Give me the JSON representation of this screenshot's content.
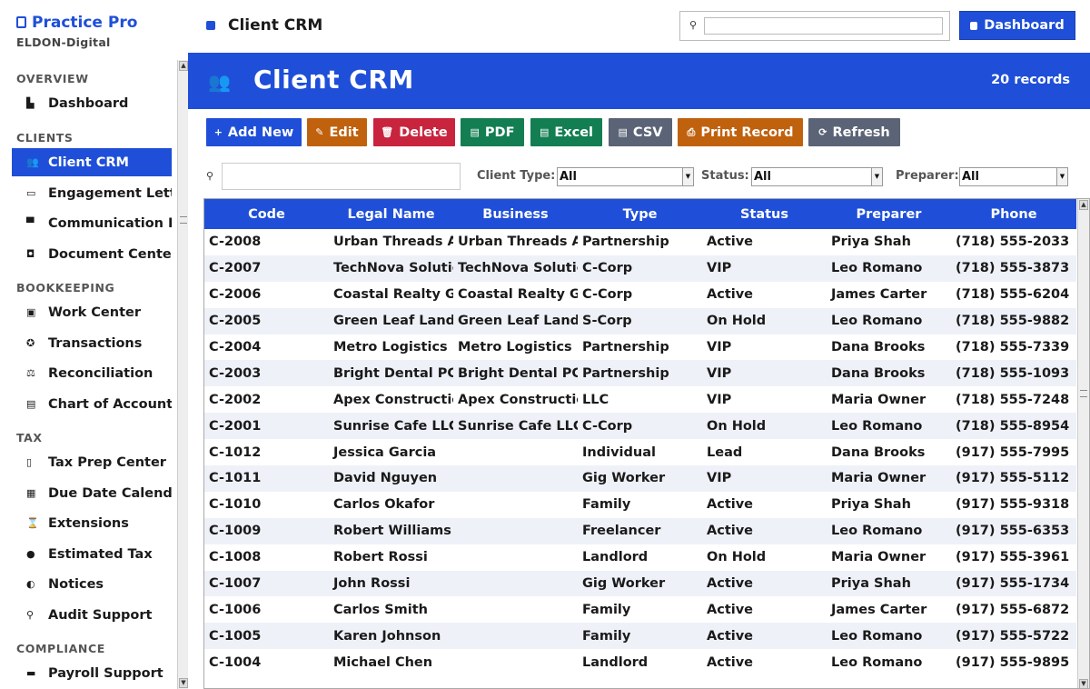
{
  "sidebar": {
    "brand": "Practice Pro",
    "org": "ELDON-Digital",
    "sections": [
      {
        "title": "OVERVIEW"
      },
      {
        "title": "CLIENTS"
      },
      {
        "title": "BOOKKEEPING"
      },
      {
        "title": "TAX"
      },
      {
        "title": "COMPLIANCE"
      }
    ],
    "items": [
      {
        "label": "Dashboard",
        "icon": "chart-icon",
        "glyph": "▙"
      },
      {
        "label": "Client CRM",
        "icon": "users-icon",
        "glyph": "👥",
        "active": true
      },
      {
        "label": "Engagement Letters",
        "icon": "link-icon",
        "glyph": "▭"
      },
      {
        "label": "Communication Log",
        "icon": "comment-icon",
        "glyph": "▀"
      },
      {
        "label": "Document Center",
        "icon": "folder-icon",
        "glyph": "◘"
      },
      {
        "label": "Work Center",
        "icon": "window-icon",
        "glyph": "▣"
      },
      {
        "label": "Transactions",
        "icon": "cycle-icon",
        "glyph": "✪"
      },
      {
        "label": "Reconciliation",
        "icon": "scale-icon",
        "glyph": "⚖"
      },
      {
        "label": "Chart of Accounts",
        "icon": "book-icon",
        "glyph": "▤"
      },
      {
        "label": "Tax Prep Center",
        "icon": "clipboard-icon",
        "glyph": "▯"
      },
      {
        "label": "Due Date Calendar",
        "icon": "calendar-icon",
        "glyph": "▦"
      },
      {
        "label": "Extensions",
        "icon": "hourglass-icon",
        "glyph": "⌛"
      },
      {
        "label": "Estimated Tax",
        "icon": "moneybag-icon",
        "glyph": "●"
      },
      {
        "label": "Notices",
        "icon": "bell-icon",
        "glyph": "◐"
      },
      {
        "label": "Audit Support",
        "icon": "magnifier-icon",
        "glyph": "⚲"
      },
      {
        "label": "Payroll Support",
        "icon": "briefcase-icon",
        "glyph": "▬"
      }
    ]
  },
  "topbar": {
    "title": "Client CRM",
    "search_placeholder": "",
    "dashboard_label": "Dashboard"
  },
  "banner": {
    "title": "Client CRM",
    "count": "20 records"
  },
  "toolbar": {
    "buttons": [
      {
        "label": "Add New",
        "glyph": "+",
        "icon": "plus-icon",
        "color": "#1f4fd8"
      },
      {
        "label": "Edit",
        "glyph": "✎",
        "icon": "pencil-icon",
        "color": "#c0610e"
      },
      {
        "label": "Delete",
        "glyph": "🗑",
        "icon": "trash-icon",
        "color": "#c8243e"
      },
      {
        "label": "PDF",
        "glyph": "▤",
        "icon": "pdf-icon",
        "color": "#127e52"
      },
      {
        "label": "Excel",
        "glyph": "▤",
        "icon": "excel-icon",
        "color": "#127e52"
      },
      {
        "label": "CSV",
        "glyph": "▤",
        "icon": "csv-icon",
        "color": "#5b6476"
      },
      {
        "label": "Print Record",
        "glyph": "⎙",
        "icon": "print-icon",
        "color": "#c0610e"
      },
      {
        "label": "Refresh",
        "glyph": "⟳",
        "icon": "refresh-icon",
        "color": "#5b6476"
      }
    ]
  },
  "filters": {
    "search_value": "",
    "client_type_label": "Client Type:",
    "client_type_value": "All",
    "status_label": "Status:",
    "status_value": "All",
    "preparer_label": "Preparer:",
    "preparer_value": "All"
  },
  "table": {
    "columns": [
      "Code",
      "Legal Name",
      "Business",
      "Type",
      "Status",
      "Preparer",
      "Phone"
    ],
    "rows": [
      [
        "C-2008",
        "Urban Threads Apparel LLC",
        "Urban Threads Apparel",
        "Partnership",
        "Active",
        "Priya Shah",
        "(718) 555-2033"
      ],
      [
        "C-2007",
        "TechNova Solutions Inc",
        "TechNova Solutions",
        "C-Corp",
        "VIP",
        "Leo Romano",
        "(718) 555-3873"
      ],
      [
        "C-2006",
        "Coastal Realty Group Inc",
        "Coastal Realty Group",
        "C-Corp",
        "Active",
        "James Carter",
        "(718) 555-6204"
      ],
      [
        "C-2005",
        "Green Leaf Landscaping",
        "Green Leaf Landscaping",
        "S-Corp",
        "On Hold",
        "Leo Romano",
        "(718) 555-9882"
      ],
      [
        "C-2004",
        "Metro Logistics LLC",
        "Metro Logistics LLC",
        "Partnership",
        "VIP",
        "Dana Brooks",
        "(718) 555-7339"
      ],
      [
        "C-2003",
        "Bright Dental PC",
        "Bright Dental PC",
        "Partnership",
        "VIP",
        "Dana Brooks",
        "(718) 555-1093"
      ],
      [
        "C-2002",
        "Apex Construction LLC",
        "Apex Construction",
        "LLC",
        "VIP",
        "Maria Owner",
        "(718) 555-7248"
      ],
      [
        "C-2001",
        "Sunrise Cafe LLC",
        "Sunrise Cafe LLC",
        "C-Corp",
        "On Hold",
        "Leo Romano",
        "(718) 555-8954"
      ],
      [
        "C-1012",
        "Jessica Garcia",
        "",
        "Individual",
        "Lead",
        "Dana Brooks",
        "(917) 555-7995"
      ],
      [
        "C-1011",
        "David Nguyen",
        "",
        "Gig Worker",
        "VIP",
        "Maria Owner",
        "(917) 555-5112"
      ],
      [
        "C-1010",
        "Carlos Okafor",
        "",
        "Family",
        "Active",
        "Priya Shah",
        "(917) 555-9318"
      ],
      [
        "C-1009",
        "Robert Williams",
        "",
        "Freelancer",
        "Active",
        "Leo Romano",
        "(917) 555-6353"
      ],
      [
        "C-1008",
        "Robert Rossi",
        "",
        "Landlord",
        "On Hold",
        "Maria Owner",
        "(917) 555-3961"
      ],
      [
        "C-1007",
        "John Rossi",
        "",
        "Gig Worker",
        "Active",
        "Priya Shah",
        "(917) 555-1734"
      ],
      [
        "C-1006",
        "Carlos Smith",
        "",
        "Family",
        "Active",
        "James Carter",
        "(917) 555-6872"
      ],
      [
        "C-1005",
        "Karen Johnson",
        "",
        "Family",
        "Active",
        "Leo Romano",
        "(917) 555-5722"
      ],
      [
        "C-1004",
        "Michael Chen",
        "",
        "Landlord",
        "Active",
        "Leo Romano",
        "(917) 555-9895"
      ]
    ]
  }
}
